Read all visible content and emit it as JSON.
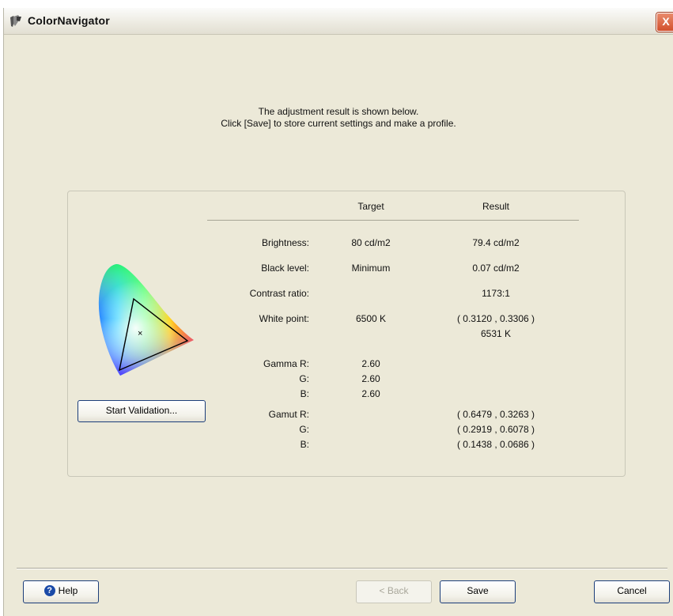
{
  "window": {
    "title": "ColorNavigator",
    "close_glyph": "X"
  },
  "instruction": {
    "line1": "The adjustment result is shown below.",
    "line2": "Click [Save] to store current settings and make a profile."
  },
  "columns": {
    "target": "Target",
    "result": "Result"
  },
  "rows": {
    "brightness": {
      "label": "Brightness:",
      "target": "80 cd/m2",
      "result": "79.4 cd/m2"
    },
    "black_level": {
      "label": "Black level:",
      "target": "Minimum",
      "result": "0.07 cd/m2"
    },
    "contrast": {
      "label": "Contrast ratio:",
      "result": "1173:1"
    },
    "white_point": {
      "label": "White point:",
      "target": "6500 K",
      "result_xy": "( 0.3120 , 0.3306 )",
      "result_k": "6531 K"
    },
    "gamma": {
      "label_r": "Gamma R:",
      "label_g": "G:",
      "label_b": "B:",
      "r": "2.60",
      "g": "2.60",
      "b": "2.60"
    },
    "gamut": {
      "label_r": "Gamut R:",
      "label_g": "G:",
      "label_b": "B:",
      "r": "( 0.6479 , 0.3263 )",
      "g": "( 0.2919 , 0.6078 )",
      "b": "( 0.1438 , 0.0686 )"
    }
  },
  "buttons": {
    "start_validation": "Start Validation...",
    "help": "Help",
    "back": "< Back",
    "save": "Save",
    "cancel": "Cancel"
  },
  "icons": {
    "app": "colornavigator-app-icon",
    "help": "help-icon",
    "close": "close-icon",
    "gamut": "cie-chromaticity-diagram"
  },
  "colors": {
    "window_bg": "#ece9d8",
    "button_border": "#1c3e7a",
    "close_button": "#d2502c"
  }
}
